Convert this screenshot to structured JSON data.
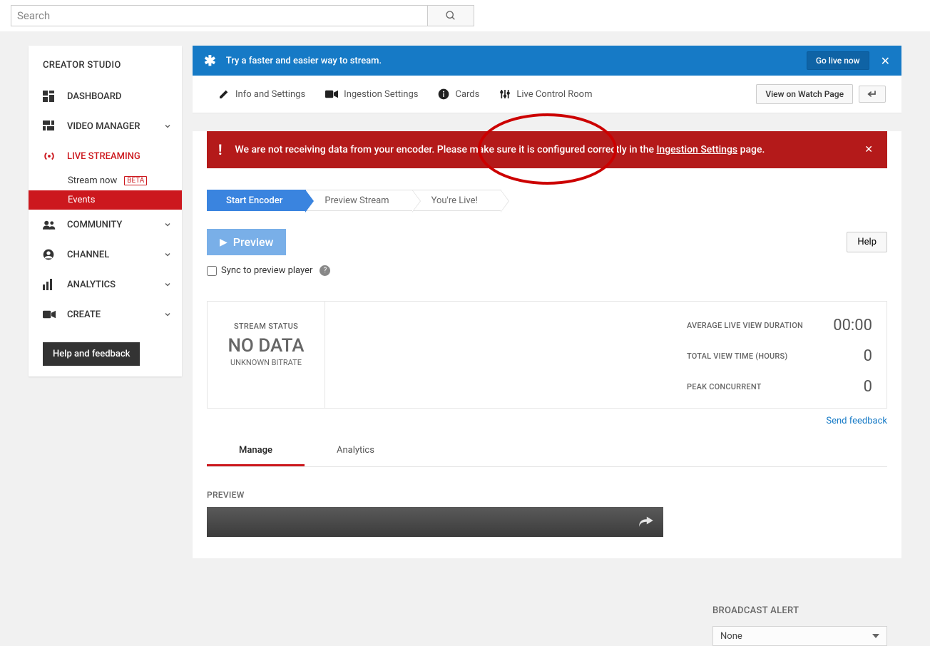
{
  "search": {
    "placeholder": "Search"
  },
  "sidebar": {
    "title": "CREATOR STUDIO",
    "items": {
      "dashboard": "DASHBOARD",
      "video_manager": "VIDEO MANAGER",
      "live_streaming": "LIVE STREAMING",
      "community": "COMMUNITY",
      "channel": "CHANNEL",
      "analytics": "ANALYTICS",
      "create": "CREATE"
    },
    "stream_now": "Stream now",
    "beta_label": "BETA",
    "events": "Events",
    "help_feedback": "Help and feedback"
  },
  "banner": {
    "text": "Try a faster and easier way to stream.",
    "go_live": "Go live now"
  },
  "tabs": {
    "info": "Info and Settings",
    "ingestion": "Ingestion Settings",
    "cards": "Cards",
    "control": "Live Control Room",
    "watch_page": "View on Watch Page"
  },
  "alert": {
    "text_a": "We are not receiving data from your encoder. Please make sure it is configured correctly in the ",
    "link": "Ingestion Settings",
    "text_b": " page."
  },
  "steps": {
    "s1": "Start Encoder",
    "s2": "Preview Stream",
    "s3": "You're Live!"
  },
  "actions": {
    "preview": "Preview",
    "help": "Help",
    "sync": "Sync to preview player"
  },
  "status": {
    "header": "STREAM STATUS",
    "value": "NO DATA",
    "sub": "UNKNOWN BITRATE"
  },
  "metrics": {
    "avg_dur_label": "AVERAGE LIVE VIEW DURATION",
    "avg_dur_val": "00:00",
    "total_time_label": "TOTAL VIEW TIME (HOURS)",
    "total_time_val": "0",
    "peak_label": "PEAK CONCURRENT",
    "peak_val": "0"
  },
  "feedback_link": "Send feedback",
  "lower_tabs": {
    "manage": "Manage",
    "analytics": "Analytics"
  },
  "preview_heading": "PREVIEW",
  "broadcast_alert": {
    "title": "BROADCAST ALERT",
    "value": "None"
  }
}
